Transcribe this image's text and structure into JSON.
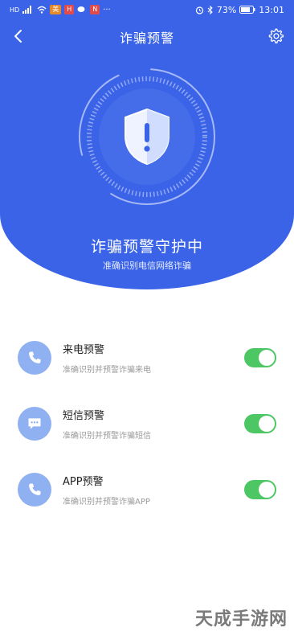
{
  "status_bar": {
    "left_text": "HD",
    "badges": [
      "美",
      "H",
      "N"
    ],
    "battery": "73%",
    "time": "13:01"
  },
  "header": {
    "title": "诈骗预警"
  },
  "hero": {
    "title": "诈骗预警守护中",
    "subtitle": "准确识别电信网络诈骗"
  },
  "list": [
    {
      "title": "来电预警",
      "desc": "准确识别并预警诈骗来电",
      "icon": "phone-icon",
      "enabled": true
    },
    {
      "title": "短信预警",
      "desc": "准确识别并预警诈骗短信",
      "icon": "message-icon",
      "enabled": true
    },
    {
      "title": "APP预警",
      "desc": "准确识别并预警诈骗APP",
      "icon": "phone-icon",
      "enabled": true
    }
  ],
  "watermark": "天成手游网",
  "colors": {
    "primary": "#3a63e8",
    "icon_bg": "#8fb0f1",
    "toggle_on": "#4cc764"
  }
}
